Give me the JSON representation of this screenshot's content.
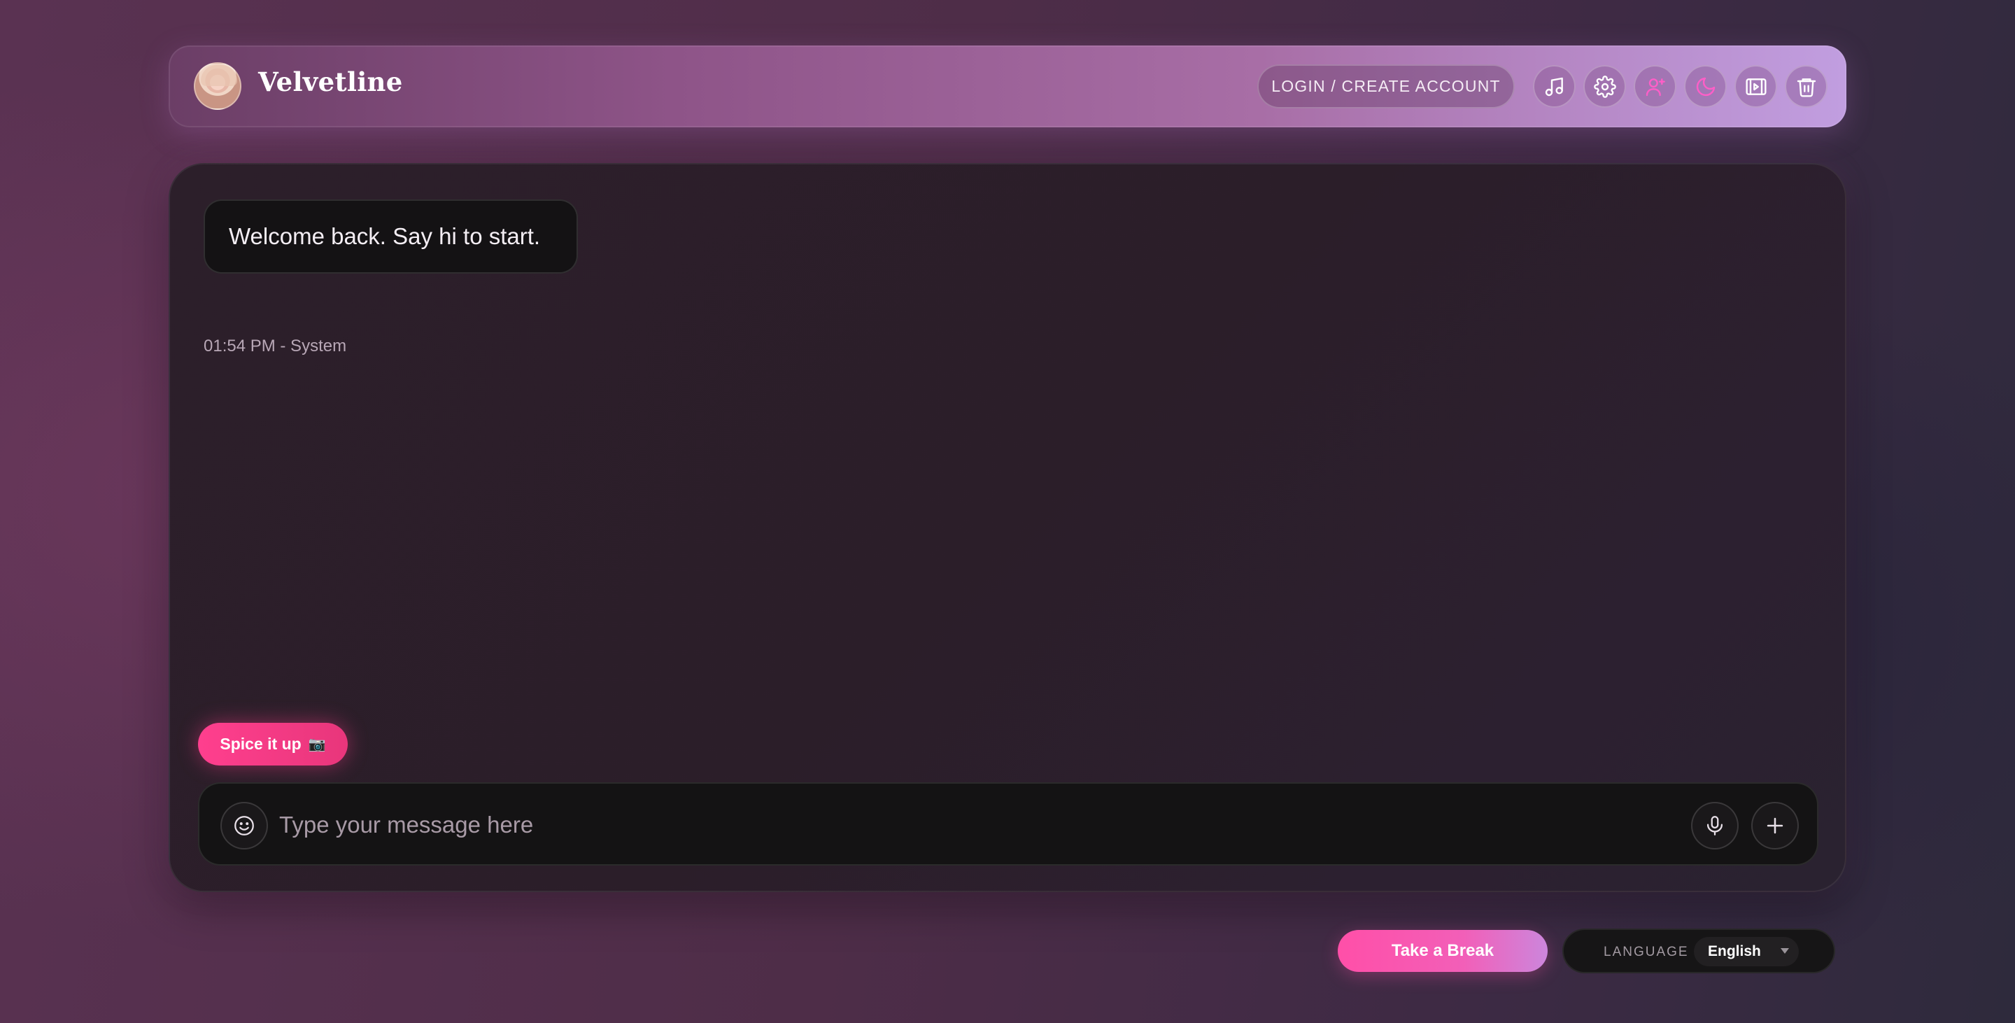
{
  "header": {
    "brand": "Velvetline",
    "avatar": "user-avatar",
    "login_label": "LOGIN / CREATE ACCOUNT",
    "icons": [
      "music-icon",
      "gear-icon",
      "user-plus-icon",
      "moon-icon",
      "gallery-icon",
      "trash-icon"
    ]
  },
  "chat": {
    "messages": [
      {
        "text": "Welcome back. Say hi to start.",
        "time": "01:54 PM",
        "sender": "System",
        "meta": "01:54 PM - System"
      }
    ],
    "spice_label": "Spice it up",
    "spice_icon": "camera-icon",
    "input": {
      "placeholder": "Type your message here",
      "value": ""
    },
    "composer_icons": [
      "smiley-icon",
      "microphone-icon",
      "plus-icon"
    ]
  },
  "footer": {
    "break_label": "Take a Break",
    "language_label": "LANGUAGE",
    "language_value": "English"
  },
  "colors": {
    "accent_pink": "#ff3f8e",
    "header_end": "#c19ee0",
    "panel_bg": "#2b1e29",
    "icon_magenta": "#ff5ec8"
  }
}
